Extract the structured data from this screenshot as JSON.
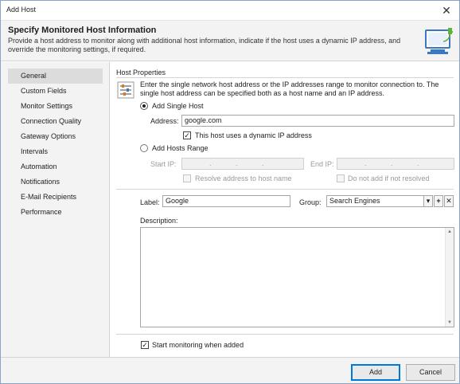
{
  "window": {
    "title": "Add Host",
    "close_glyph": "✕"
  },
  "header": {
    "title": "Specify Monitored Host Information",
    "description": "Provide a host address to monitor along with additional host information, indicate if the host uses a dynamic IP address, and override the monitoring settings, if required.",
    "icon": "monitor-plug-icon"
  },
  "sidebar": {
    "items": [
      {
        "label": "General",
        "active": true
      },
      {
        "label": "Custom Fields"
      },
      {
        "label": "Monitor Settings"
      },
      {
        "label": "Connection Quality"
      },
      {
        "label": "Gateway Options"
      },
      {
        "label": "Intervals"
      },
      {
        "label": "Automation"
      },
      {
        "label": "Notifications"
      },
      {
        "label": "E-Mail Recipients"
      },
      {
        "label": "Performance"
      }
    ]
  },
  "host_properties": {
    "section_title": "Host Properties",
    "icon": "sliders-icon",
    "description": "Enter the single network host address or the IP addresses range to monitor connection to. The single host address can be specified both as a host name and an IP address.",
    "single_host": {
      "label": "Add Single Host",
      "selected": true,
      "address_label": "Address:",
      "address_value": "google.com",
      "dynamic_ip_label": "This host uses a dynamic IP address",
      "dynamic_ip_checked": true
    },
    "hosts_range": {
      "label": "Add Hosts Range",
      "selected": false,
      "start_ip_label": "Start IP:",
      "start_ip_value": ". . .",
      "end_ip_label": "End IP:",
      "end_ip_value": ". . .",
      "resolve_label": "Resolve address to host name",
      "do_not_add_label": "Do not add if not resolved"
    }
  },
  "label_field": {
    "label": "Label:",
    "value": "Google"
  },
  "group_field": {
    "label": "Group:",
    "value": "Search Engines",
    "dropdown_glyph": "▾",
    "add_glyph": "+",
    "remove_glyph": "✕"
  },
  "description_field": {
    "label": "Description:",
    "value": ""
  },
  "start_monitoring": {
    "label": "Start monitoring when added",
    "checked": true
  },
  "footer": {
    "add_label": "Add",
    "cancel_label": "Cancel"
  },
  "colors": {
    "accent": "#0078d7",
    "header_bg": "#f3f3f3"
  }
}
